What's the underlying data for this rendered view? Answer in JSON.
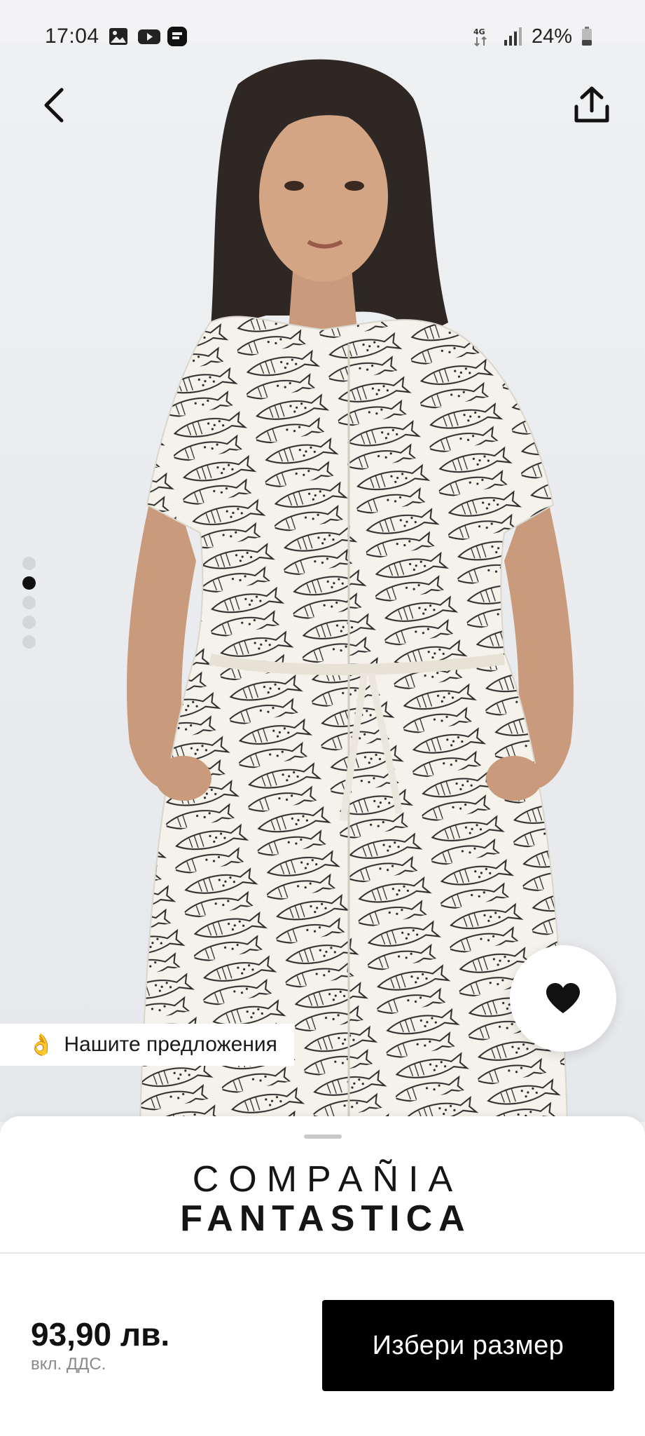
{
  "status_bar": {
    "time": "17:04",
    "network": "4G",
    "battery": "24%",
    "left_icons": [
      "gallery-icon",
      "youtube-icon",
      "about-you-app-icon"
    ],
    "right_icons": [
      "data-4g-icon",
      "signal-icon",
      "battery-icon"
    ]
  },
  "product": {
    "image_pages": 5,
    "active_page": 2,
    "offer_label": "Нашите предложения",
    "offer_emoji": "👌",
    "brand_line1": "COMPAÑIA",
    "brand_line2": "FANTASTICA",
    "price": "93,90 лв.",
    "vat_note": "вкл. ДДС.",
    "cta_label": "Избери размер"
  },
  "colors": {
    "accent": "#000000",
    "background": "#f3f3f5",
    "dress": "#f4f2ea",
    "pattern": "#2b2b2b"
  }
}
